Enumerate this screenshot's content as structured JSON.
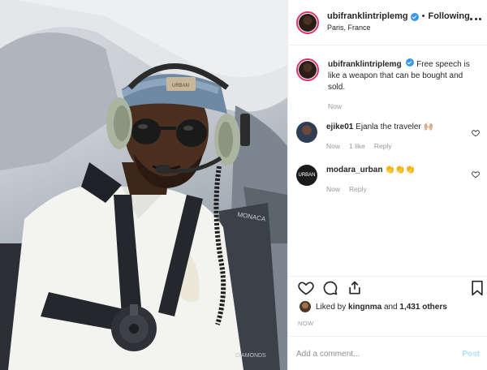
{
  "post": {
    "username": "ubifranklintriplemg",
    "follow_status": "Following",
    "location": "Paris, France",
    "caption": "Free speech is like a weapon that can be bought and sold.",
    "caption_time": "Now"
  },
  "photo": {
    "visor_text": "URBAN",
    "seat_text": "MONACA",
    "chair_text": "DIAMONDS"
  },
  "comments": [
    {
      "username": "ejike01",
      "text": "Ejanla the traveler 🙌🏼",
      "time": "Now",
      "likes": "1 like",
      "reply": "Reply"
    },
    {
      "username": "modara_urban",
      "text": "👏👏👏",
      "time": "Now",
      "reply": "Reply",
      "avatar_text": "URBAN"
    }
  ],
  "engagement": {
    "liked_by_prefix": "Liked by",
    "liked_by_user": "kingnma",
    "and_text": "and",
    "others_count": "1,431 others",
    "timestamp": "NOW"
  },
  "add_comment": {
    "placeholder": "Add a comment...",
    "post_label": "Post"
  },
  "icons": {
    "like": "heart-icon",
    "comment": "comment-icon",
    "share": "share-icon",
    "save": "bookmark-icon",
    "more": "more-options-icon",
    "verified": "verified-badge-icon"
  },
  "colors": {
    "verified_blue": "#3897f0",
    "post_button": "#b2dffc",
    "muted_text": "#999999",
    "story_ring": "#e1306c"
  }
}
